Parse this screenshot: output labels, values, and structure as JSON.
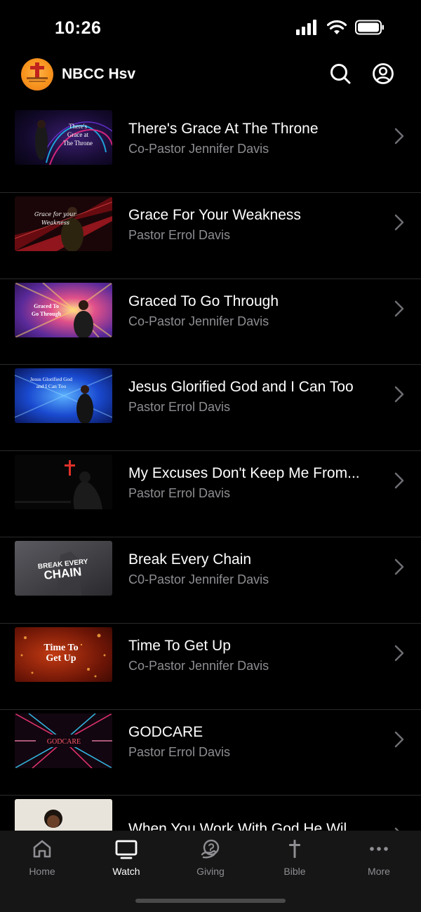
{
  "status_bar": {
    "time": "10:26"
  },
  "header": {
    "title": "NBCC Hsv",
    "logo_text": ""
  },
  "sermons": [
    {
      "title": "There's Grace At The Throne",
      "speaker": "Co-Pastor Jennifer Davis",
      "thumb_text": "There's Grace at The Throne"
    },
    {
      "title": "Grace For Your Weakness",
      "speaker": "Pastor Errol Davis",
      "thumb_text": "Grace for your Weakness"
    },
    {
      "title": "Graced To Go Through",
      "speaker": "Co-Pastor Jennifer Davis",
      "thumb_text": "Graced To Go Through"
    },
    {
      "title": "Jesus Glorified God and I Can Too",
      "speaker": "Pastor Errol Davis",
      "thumb_text": "Jesus Glorified God and I Can Too"
    },
    {
      "title": "My Excuses Don't Keep Me From...",
      "speaker": "Pastor Errol Davis",
      "thumb_text": ""
    },
    {
      "title": "Break Every Chain",
      "speaker": "C0-Pastor Jennifer Davis",
      "thumb_text": "BREAK EVERY CHAIN"
    },
    {
      "title": "Time To Get Up",
      "speaker": "Co-Pastor Jennifer Davis",
      "thumb_text": "Time To Get Up"
    },
    {
      "title": "GODCARE",
      "speaker": "Pastor Errol Davis",
      "thumb_text": "GODCARE"
    },
    {
      "title": "When You Work With God He Wil...",
      "speaker": "",
      "thumb_text": ""
    }
  ],
  "tabs": [
    {
      "label": "Home",
      "icon": "home-icon"
    },
    {
      "label": "Watch",
      "icon": "tv-icon",
      "active": true
    },
    {
      "label": "Giving",
      "icon": "giving-icon"
    },
    {
      "label": "Bible",
      "icon": "cross-icon"
    },
    {
      "label": "More",
      "icon": "more-icon"
    }
  ],
  "colors": {
    "background": "#000000",
    "subtitle": "#8e8e93",
    "divider": "#2a2a2c",
    "logo": "#f7941d"
  }
}
